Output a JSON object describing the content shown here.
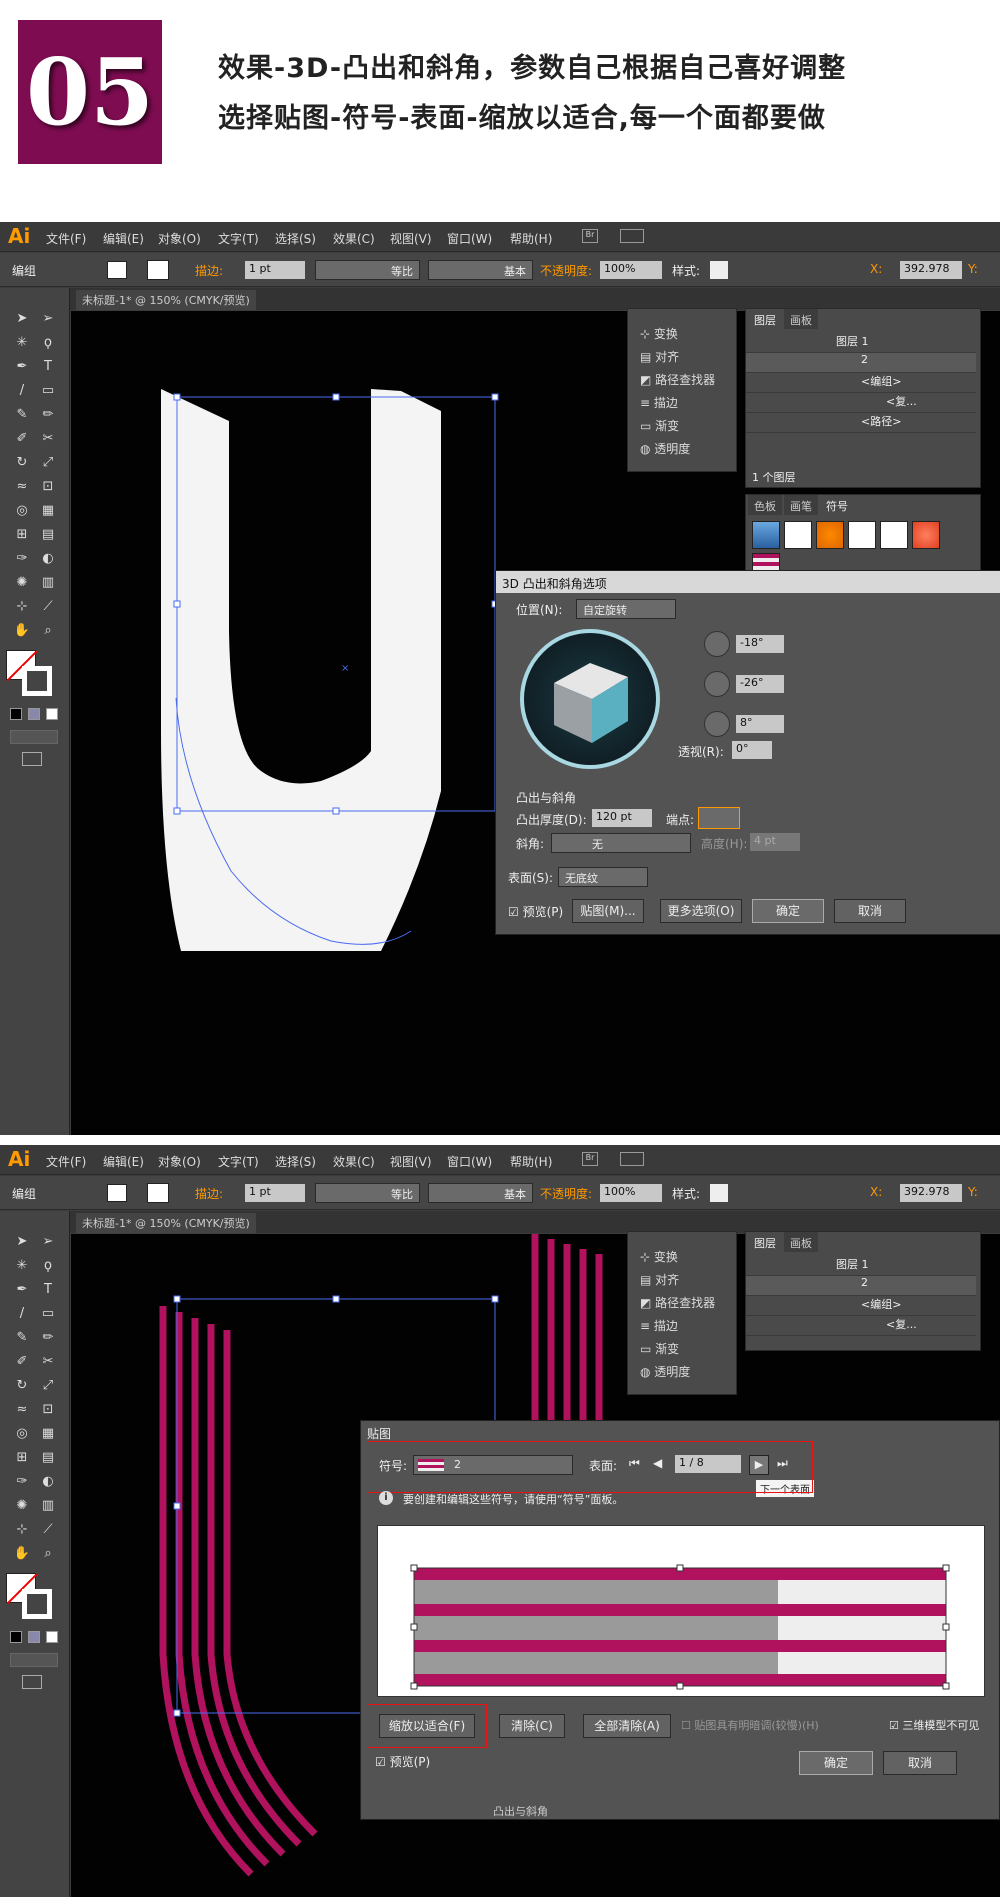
{
  "header": {
    "step_number": "05",
    "line1": "效果-3D-凸出和斜角，参数自己根据自己喜好调整",
    "line2": "选择贴图-符号-表面-缩放以适合,每一个面都要做"
  },
  "app": {
    "logo": "Ai",
    "menus": [
      "文件(F)",
      "编辑(E)",
      "对象(O)",
      "文字(T)",
      "选择(S)",
      "效果(C)",
      "视图(V)",
      "窗口(W)",
      "帮助(H)"
    ],
    "options_bar": {
      "group_label": "编组",
      "stroke_label": "描边:",
      "stroke_value": "1 pt",
      "stroke_profile": "等比",
      "brush": "基本",
      "opacity_label": "不透明度:",
      "opacity_value": "100%",
      "style_label": "样式:",
      "x_label": "X:",
      "x_value": "392.978",
      "y_label": "Y:"
    },
    "doc_tab": "未标题-1* @ 150% (CMYK/预览)",
    "side_panel": {
      "items": [
        "变换",
        "对齐",
        "路径查找器",
        "描边",
        "渐变",
        "透明度"
      ]
    },
    "layers_panel": {
      "tabs": [
        "图层",
        "画板"
      ],
      "rows": [
        "图层 1",
        "2",
        "<编组>",
        "<复...",
        "<路径>"
      ],
      "footer": "1 个图层"
    },
    "symbols_panel": {
      "tabs": [
        "色板",
        "画笔",
        "符号"
      ]
    }
  },
  "dialog_3d": {
    "title": "3D 凸出和斜角选项",
    "position_label": "位置(N):",
    "position_value": "自定旋转",
    "angle_x": "-18°",
    "angle_y": "-26°",
    "angle_z": "8°",
    "perspective_label": "透视(R):",
    "perspective_value": "0°",
    "extrude_section": "凸出与斜角",
    "depth_label": "凸出厚度(D):",
    "depth_value": "120 pt",
    "cap_label": "端点:",
    "bevel_label": "斜角:",
    "bevel_value": "无",
    "height_label": "高度(H):",
    "height_value": "4 pt",
    "surface_label": "表面(S):",
    "surface_value": "无底纹",
    "preview_label": "预览(P)",
    "map_button": "贴图(M)...",
    "more_button": "更多选项(O)",
    "ok_button": "确定",
    "cancel_button": "取消"
  },
  "dialog_map": {
    "title": "贴图",
    "symbol_label": "符号:",
    "symbol_value": "2",
    "surface_label": "表面:",
    "surface_value": "1 / 8",
    "tooltip": "下一个表面",
    "info_text": "要创建和编辑这些符号，请使用“符号”面板。",
    "scale_fit_button": "缩放以适合(F)",
    "clear_button": "清除(C)",
    "clear_all_button": "全部清除(A)",
    "shade_label": "贴图具有明暗调(较慢)(H)",
    "invisible_label": "三维模型不可见",
    "preview_label": "预览(P)",
    "ok_button": "确定",
    "cancel_button": "取消",
    "bottom_partial": "凸出与斜角"
  },
  "colors": {
    "badge": "#7e0c51",
    "accent_orange": "#ff9a00",
    "magenta": "#b0125e",
    "selection": "#4a6cf0"
  }
}
